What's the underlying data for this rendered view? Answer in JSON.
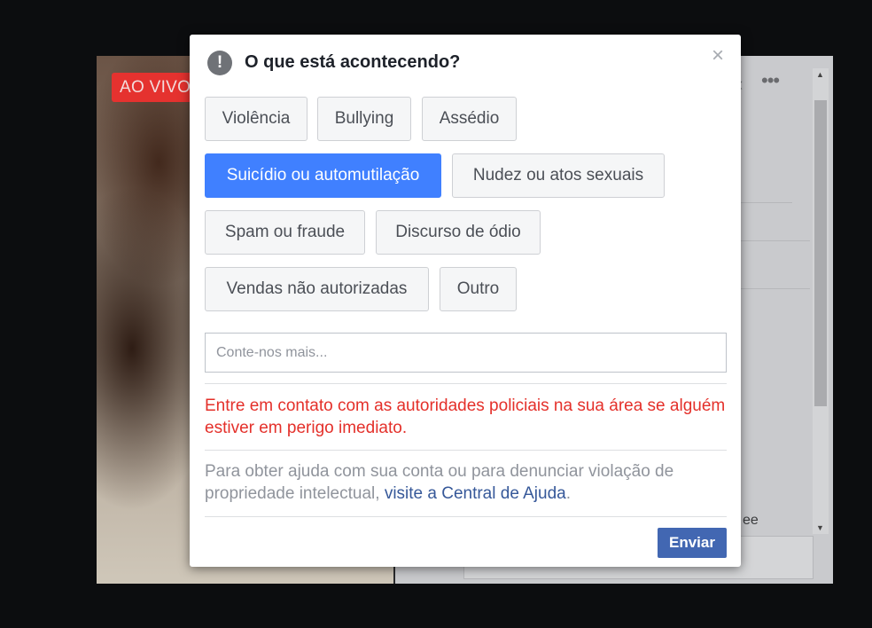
{
  "background": {
    "live_badge": "AO VIVO",
    "text_fragment": "ee"
  },
  "dialog": {
    "title": "O que está acontecendo?",
    "close_label": "×",
    "warning_icon": "exclamation-circle-icon",
    "options": [
      {
        "label": "Violência",
        "selected": false
      },
      {
        "label": "Bullying",
        "selected": false
      },
      {
        "label": "Assédio",
        "selected": false
      },
      {
        "label": "Suicídio ou automutilação",
        "selected": true
      },
      {
        "label": "Nudez ou atos sexuais",
        "selected": false
      },
      {
        "label": "Spam ou fraude",
        "selected": false
      },
      {
        "label": "Discurso de ódio",
        "selected": false
      },
      {
        "label": "Vendas não autorizadas",
        "selected": false
      },
      {
        "label": "Outro",
        "selected": false
      }
    ],
    "details_placeholder": "Conte-nos mais...",
    "details_value": "",
    "warning_text": "Entre em contato com as autoridades policiais na sua área se alguém estiver em perigo imediato.",
    "help_text_before": "Para obter ajuda com sua conta ou para denunciar violação de propriedade intelectual, ",
    "help_link": "visite a Central de Ajuda",
    "help_text_after": ".",
    "send_label": "Enviar"
  },
  "colors": {
    "selected_option": "#4080ff",
    "send_button": "#4267b2",
    "warning_text": "#e4302a",
    "link": "#365899"
  }
}
